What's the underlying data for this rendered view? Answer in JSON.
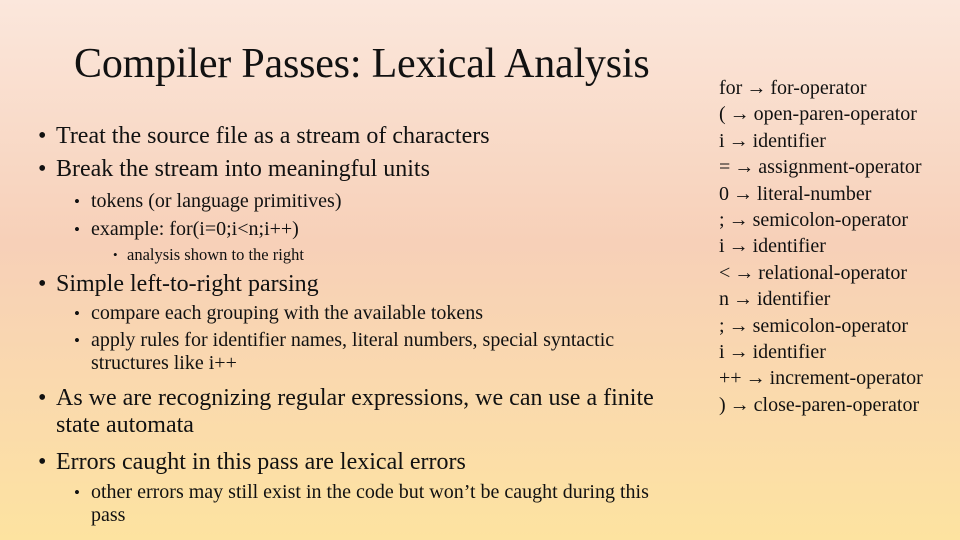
{
  "slide": {
    "title": "Compiler Passes:  Lexical Analysis",
    "bullets": [
      {
        "text": "Treat the source file as a stream of characters"
      },
      {
        "text": "Break the stream into meaningful units",
        "sub": [
          {
            "text": "tokens (or language primitives)"
          },
          {
            "text": "example:  for(i=0;i<n;i++)",
            "sub": [
              {
                "text": "analysis shown to the right"
              }
            ]
          }
        ]
      },
      {
        "text": "Simple left-to-right parsing",
        "sub": [
          {
            "text": "compare each grouping with the available tokens"
          },
          {
            "text": "apply rules for identifier names, literal numbers, special syntactic structures like i++"
          }
        ]
      },
      {
        "text": "As we are recognizing regular expressions, we can use a finite state automata"
      },
      {
        "text": "Errors caught in this pass are lexical errors",
        "sub": [
          {
            "text": "other errors may still exist in the code but won’t be caught during this pass"
          }
        ]
      }
    ],
    "arrow_icon": "→",
    "tokens": [
      {
        "lexeme": "for",
        "token": "for-operator"
      },
      {
        "lexeme": "(",
        "token": "open-paren-operator"
      },
      {
        "lexeme": "i",
        "token": "identifier"
      },
      {
        "lexeme": "=",
        "token": "assignment-operator"
      },
      {
        "lexeme": "0",
        "token": "literal-number"
      },
      {
        "lexeme": ";",
        "token": "semicolon-operator"
      },
      {
        "lexeme": "i",
        "token": "identifier"
      },
      {
        "lexeme": "<",
        "token": "relational-operator"
      },
      {
        "lexeme": "n",
        "token": "identifier"
      },
      {
        "lexeme": ";",
        "token": "semicolon-operator"
      },
      {
        "lexeme": "i",
        "token": "identifier"
      },
      {
        "lexeme": "++",
        "token": "increment-operator"
      },
      {
        "lexeme": ")",
        "token": "close-paren-operator"
      }
    ]
  }
}
